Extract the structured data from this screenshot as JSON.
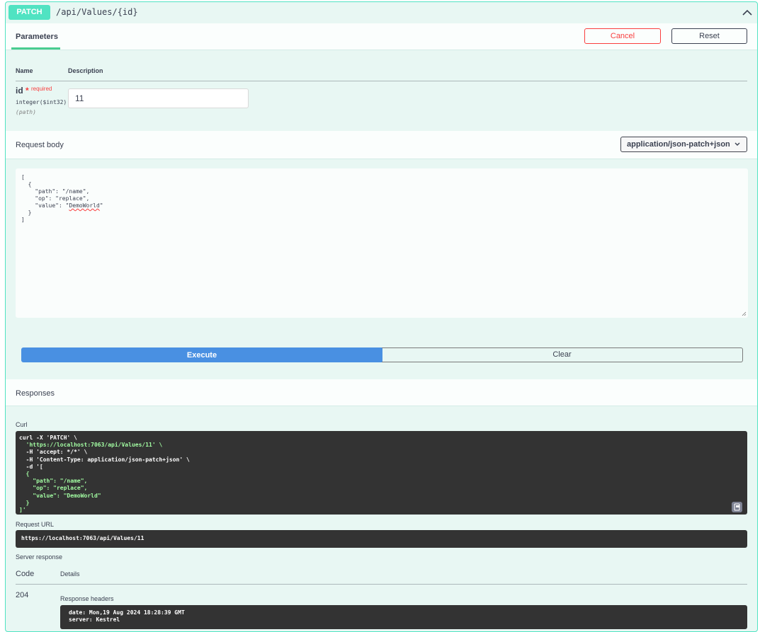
{
  "operation": {
    "method": "PATCH",
    "path": "/api/Values/{id}"
  },
  "parameters": {
    "title": "Parameters",
    "cancel_label": "Cancel",
    "reset_label": "Reset",
    "col_name": "Name",
    "col_description": "Description",
    "items": [
      {
        "name": "id",
        "star": "*",
        "required_label": "required",
        "type": "integer($int32)",
        "in": "(path)",
        "value": "11"
      }
    ]
  },
  "request_body": {
    "title": "Request body",
    "content_type": "application/json-patch+json",
    "lines": [
      "[",
      "  {",
      "    \"path\": \"/name\",",
      "    \"op\": \"replace\",",
      "    \"value\": \"",
      "DemoWorld",
      "\"",
      "  }",
      "]"
    ]
  },
  "actions": {
    "execute_label": "Execute",
    "clear_label": "Clear"
  },
  "responses": {
    "title": "Responses",
    "curl_label": "Curl",
    "curl_lines": [
      "curl -X 'PATCH' \\",
      "  'https://localhost:7063/api/Values/11' \\",
      "  -H 'accept: */*' \\",
      "  -H 'Content-Type: application/json-patch+json' \\",
      "  -d '[",
      "  {",
      "    \"path\": \"/name\",",
      "    \"op\": \"replace\",",
      "    \"value\": \"DemoWorld\"",
      "  }",
      "]'"
    ],
    "request_url_label": "Request URL",
    "request_url": "https://localhost:7063/api/Values/11",
    "server_response_label": "Server response",
    "col_code": "Code",
    "col_details": "Details",
    "code": "204",
    "response_headers_label": "Response headers",
    "headers": [
      "date: Mon,19 Aug 2024 18:28:39 GMT",
      "server: Kestrel"
    ]
  },
  "colors": {
    "patch_accent": "#50e3c2",
    "execute_blue": "#4990e2",
    "cancel_red": "#f93e3e"
  },
  "icons": {
    "collapse": "chevron-up-icon",
    "select": "chevron-down-icon",
    "copy": "copy-to-clipboard-icon"
  }
}
